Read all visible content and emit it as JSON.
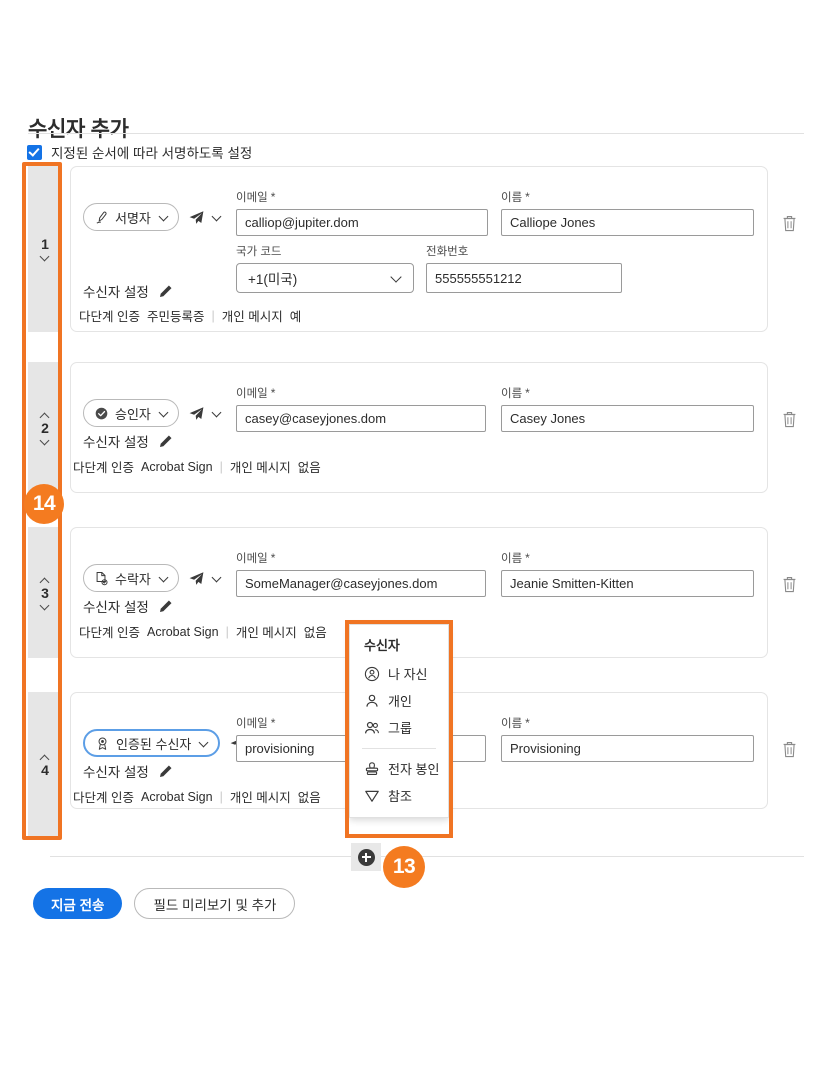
{
  "page": {
    "title": "수신자 추가",
    "order_checkbox_label": "지정된 순서에 따라 서명하도록 설정",
    "order_checkbox_checked": true
  },
  "labels": {
    "email": "이메일",
    "name": "이름",
    "country_code": "국가 코드",
    "phone": "전화번호",
    "required_mark": "*",
    "recipient_settings": "수신자 설정",
    "auth_key": "다단계 인증",
    "message_key": "개인 메시지"
  },
  "recipients": [
    {
      "order": "1",
      "role": "서명자",
      "role_icon": "signature-pen-icon",
      "email": "calliop@jupiter.dom",
      "name": "Calliope Jones",
      "country_code": "+1(미국)",
      "phone": "555555551212",
      "auth_value": "주민등록증",
      "message_value": "예",
      "has_phone": true,
      "focused": false,
      "chev_up": false,
      "chev_down": true
    },
    {
      "order": "2",
      "role": "승인자",
      "role_icon": "check-circle-icon",
      "email": "casey@caseyjones.dom",
      "name": "Casey Jones",
      "auth_value": "Acrobat Sign",
      "message_value": "없음",
      "has_phone": false,
      "focused": false,
      "chev_up": true,
      "chev_down": true
    },
    {
      "order": "3",
      "role": "수락자",
      "role_icon": "document-check-icon",
      "email": "SomeManager@caseyjones.dom",
      "name": "Jeanie Smitten-Kitten",
      "auth_value": "Acrobat Sign",
      "message_value": "없음",
      "has_phone": false,
      "focused": false,
      "chev_up": true,
      "chev_down": true
    },
    {
      "order": "4",
      "role": "인증된 수신자",
      "role_icon": "certified-badge-icon",
      "email": "provisioning",
      "name": "Provisioning",
      "auth_value": "Acrobat Sign",
      "message_value": "없음",
      "has_phone": false,
      "focused": true,
      "chev_up": true,
      "chev_down": false
    }
  ],
  "menu": {
    "header": "수신자",
    "items": [
      {
        "label": "나 자신",
        "icon": "person-circle-icon"
      },
      {
        "label": "개인",
        "icon": "person-icon"
      },
      {
        "label": "그룹",
        "icon": "group-icon"
      }
    ],
    "items2": [
      {
        "label": "전자 봉인",
        "icon": "stamp-icon"
      },
      {
        "label": "참조",
        "icon": "cc-send-icon"
      }
    ]
  },
  "footer": {
    "add_recipient_icon": "plus-circle-icon",
    "send_now": "지금 전송",
    "preview_add_fields": "필드 미리보기 및 추가"
  },
  "annotations": [
    {
      "id": "14",
      "target": "recipient-order-rail"
    },
    {
      "id": "13",
      "target": "add-recipient-button"
    }
  ],
  "colors": {
    "accent_blue": "#1473e6",
    "annotation_orange": "#f47b20",
    "rail_gray": "#e6e6e6",
    "border_gray": "#e4e4e4"
  }
}
